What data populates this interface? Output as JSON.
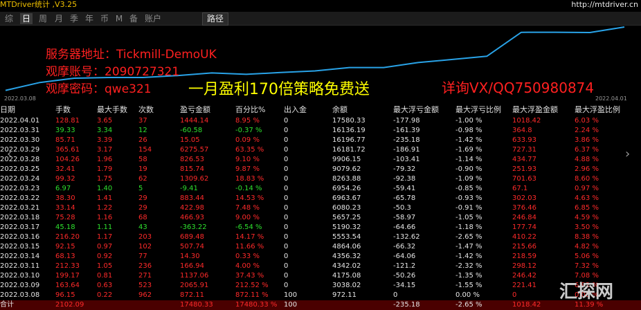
{
  "app": {
    "title": "MTDriver统计 ,V3.25",
    "url": "http://mtdriver.cn"
  },
  "tabs": [
    "综",
    "日",
    "周",
    "月",
    "季",
    "年",
    "币",
    "M",
    "备",
    "账户"
  ],
  "active_tab": 1,
  "path_button": "路径",
  "chart": {
    "start_label": "2022.03.08",
    "end_label": "2022.04.01",
    "line_color": "#29a3e8"
  },
  "overlay": {
    "server": "服务器地址：Tickmill-DemoUK",
    "account": "观摩账号：2090727321",
    "password": "观摩密码：qwe321",
    "promo": "一月盈利170倍策略免费送",
    "contact": "详询VX/QQ750980874"
  },
  "columns": [
    "日期",
    "手数",
    "最大手数",
    "次数",
    "盈亏金额",
    "百分比%",
    "出入金",
    "余额",
    "最大浮亏金额",
    "最大浮亏比例",
    "最大浮盈金额",
    "最大浮盈比例"
  ],
  "rows": [
    [
      "2022.04.01",
      "128.81",
      "3.65",
      "37",
      "1444.14",
      "8.95 %",
      "0",
      "17580.33",
      "-177.98",
      "-1.00 %",
      "1018.42",
      "6.03 %"
    ],
    [
      "2022.03.31",
      "39.33",
      "3.34",
      "12",
      "-60.58",
      "-0.37 %",
      "0",
      "16136.19",
      "-161.39",
      "-0.98 %",
      "364.8",
      "2.24 %"
    ],
    [
      "2022.03.30",
      "85.71",
      "3.39",
      "26",
      "15.05",
      "0.09 %",
      "0",
      "16196.77",
      "-235.18",
      "-1.42 %",
      "633.93",
      "3.86 %"
    ],
    [
      "2022.03.29",
      "365.61",
      "3.17",
      "154",
      "6275.57",
      "63.35 %",
      "0",
      "16181.72",
      "-186.91",
      "-1.69 %",
      "727.31",
      "6.37 %"
    ],
    [
      "2022.03.28",
      "104.26",
      "1.96",
      "58",
      "826.53",
      "9.10 %",
      "0",
      "9906.15",
      "-103.41",
      "-1.14 %",
      "434.77",
      "4.88 %"
    ],
    [
      "2022.03.25",
      "32.41",
      "1.79",
      "19",
      "815.74",
      "9.87 %",
      "0",
      "9079.62",
      "-79.32",
      "-0.90 %",
      "251.93",
      "2.96 %"
    ],
    [
      "2022.03.24",
      "99.32",
      "1.75",
      "62",
      "1309.62",
      "18.83 %",
      "0",
      "8263.88",
      "-92.38",
      "-1.09 %",
      "701.63",
      "8.60 %"
    ],
    [
      "2022.03.23",
      "6.97",
      "1.40",
      "5",
      "-9.41",
      "-0.14 %",
      "0",
      "6954.26",
      "-59.41",
      "-0.85 %",
      "67.1",
      "0.97 %"
    ],
    [
      "2022.03.22",
      "38.30",
      "1.41",
      "29",
      "883.44",
      "14.53 %",
      "0",
      "6963.67",
      "-65.78",
      "-0.93 %",
      "302.03",
      "4.63 %"
    ],
    [
      "2022.03.21",
      "33.14",
      "1.22",
      "29",
      "422.98",
      "7.48 %",
      "0",
      "6080.23",
      "-50.3",
      "-0.91 %",
      "376.46",
      "6.85 %"
    ],
    [
      "2022.03.18",
      "75.28",
      "1.16",
      "68",
      "466.93",
      "9.00 %",
      "0",
      "5657.25",
      "-58.97",
      "-1.05 %",
      "246.84",
      "4.59 %"
    ],
    [
      "2022.03.17",
      "45.18",
      "1.11",
      "43",
      "-363.22",
      "-6.54 %",
      "0",
      "5190.32",
      "-64.66",
      "-1.18 %",
      "177.74",
      "3.50 %"
    ],
    [
      "2022.03.16",
      "216.20",
      "1.17",
      "203",
      "689.48",
      "14.17 %",
      "0",
      "5553.54",
      "-132.62",
      "-2.65 %",
      "410.22",
      "8.38 %"
    ],
    [
      "2022.03.15",
      "92.15",
      "0.97",
      "102",
      "507.74",
      "11.66 %",
      "0",
      "4864.06",
      "-66.32",
      "-1.47 %",
      "215.66",
      "4.82 %"
    ],
    [
      "2022.03.14",
      "68.13",
      "0.92",
      "77",
      "14.30",
      "0.33 %",
      "0",
      "4356.32",
      "-64.06",
      "-1.42 %",
      "218.59",
      "5.06 %"
    ],
    [
      "2022.03.11",
      "212.33",
      "1.05",
      "236",
      "166.94",
      "4.00 %",
      "0",
      "4342.02",
      "-121.2",
      "-2.32 %",
      "298.12",
      "7.32 %"
    ],
    [
      "2022.03.10",
      "199.17",
      "0.81",
      "271",
      "1137.06",
      "37.43 %",
      "0",
      "4175.08",
      "-50.26",
      "-1.35 %",
      "246.42",
      "7.08 %"
    ],
    [
      "2022.03.09",
      "163.64",
      "0.63",
      "523",
      "2065.91",
      "212.52 %",
      "0",
      "3038.02",
      "-34.15",
      "-1.55 %",
      "221.41",
      "6.92 %"
    ],
    [
      "2022.03.08",
      "96.15",
      "0.22",
      "962",
      "872.11",
      "872.11 %",
      "100",
      "972.11",
      "0",
      "0.00 %",
      "0",
      "0.00 %"
    ]
  ],
  "row_color": {
    "green_rows": [
      1,
      7,
      11
    ]
  },
  "total": [
    "合计",
    "2102.09",
    "",
    "",
    "17480.33",
    "17480.33 %",
    "100",
    "",
    "-235.18",
    "-2.65 %",
    "1018.42",
    "11.39 %"
  ],
  "watermark": "汇探网",
  "equity_balance": [
    972.11,
    3038.02,
    4175.08,
    4342.02,
    4356.32,
    4864.06,
    5553.54,
    5190.32,
    5657.25,
    6080.23,
    6963.67,
    6954.26,
    8263.88,
    9079.62,
    9906.15,
    16181.72,
    16196.77,
    16136.19,
    17580.33
  ]
}
